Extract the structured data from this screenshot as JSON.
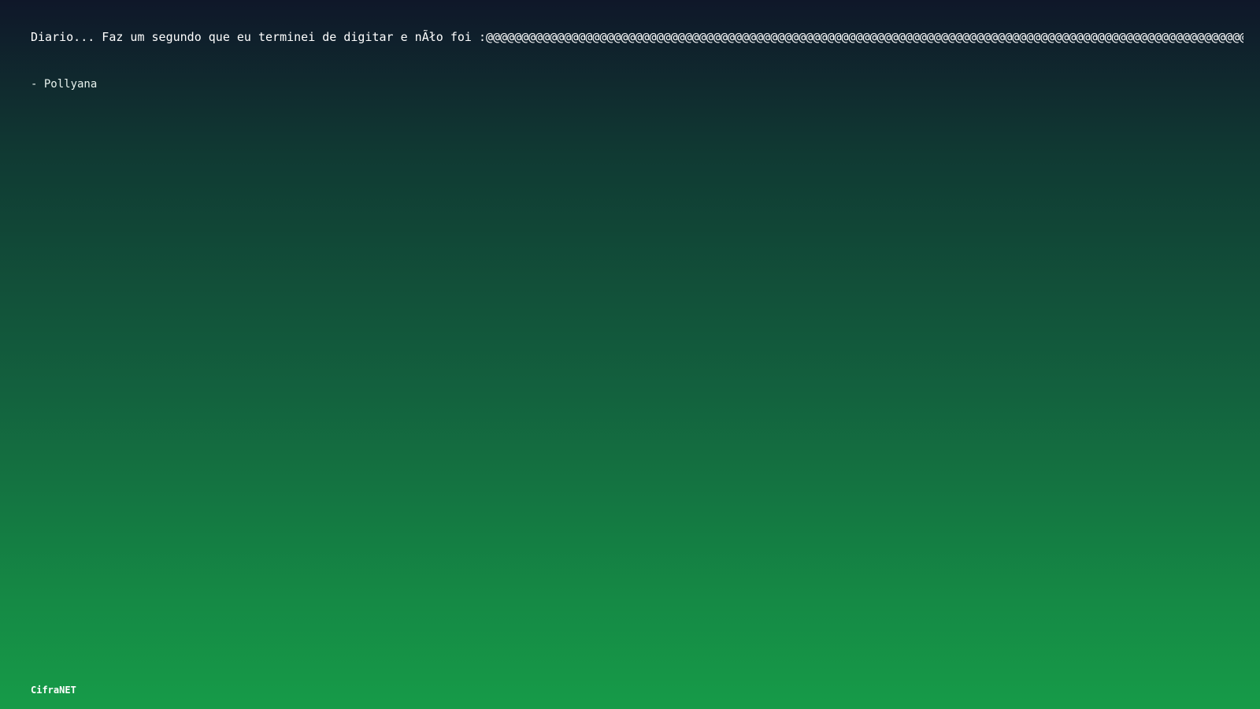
{
  "quote": {
    "text": "Diario... Faz um segundo que eu terminei de digitar e nÃło foi :@@@@@@@@@@@@@@@@@@@@@@@@@@@@@@@@@@@@@@@@@@@@@@@@@@@@@@@@@@@@@@@@@@@@@@@@@@@@@@@@@@@@@@@@@@@@@@@@@@@@@@@@@@@@@@@@..."
  },
  "author": {
    "text": "- Pollyana"
  },
  "footer": {
    "brand": "CifraNET"
  }
}
